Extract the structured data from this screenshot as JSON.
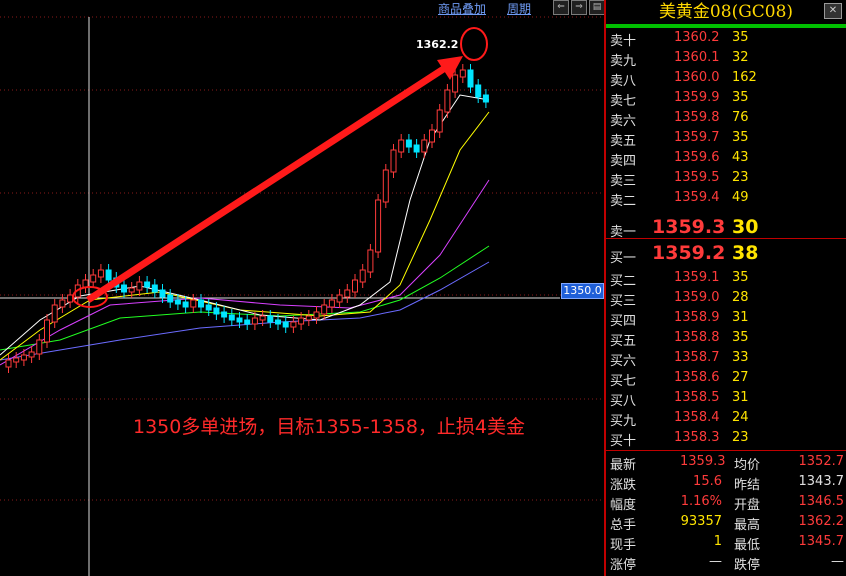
{
  "toolbar": {
    "overlay_label": "商品叠加",
    "period_label": "周期"
  },
  "chart": {
    "peak_label": "1362.2",
    "current_price_tag": "1350.0",
    "annotation": "1350多单进场，目标1355-1358，止损4美金",
    "colors": {
      "up": "#ff3b3b",
      "down": "#00e5ff",
      "ma5": "#ffffff",
      "ma10": "#ffff00",
      "ma20": "#d840ff",
      "ma30": "#22ff22",
      "ma60": "#6b6bff",
      "arrow": "#ff1a1a"
    }
  },
  "panel": {
    "title": "美黄金08(GC08)",
    "asks": [
      {
        "label": "卖十",
        "price": "1360.2",
        "vol": "35"
      },
      {
        "label": "卖九",
        "price": "1360.1",
        "vol": "32"
      },
      {
        "label": "卖八",
        "price": "1360.0",
        "vol": "162"
      },
      {
        "label": "卖七",
        "price": "1359.9",
        "vol": "35"
      },
      {
        "label": "卖六",
        "price": "1359.8",
        "vol": "76"
      },
      {
        "label": "卖五",
        "price": "1359.7",
        "vol": "35"
      },
      {
        "label": "卖四",
        "price": "1359.6",
        "vol": "43"
      },
      {
        "label": "卖三",
        "price": "1359.5",
        "vol": "23"
      },
      {
        "label": "卖二",
        "price": "1359.4",
        "vol": "49"
      },
      {
        "label": "卖一",
        "price": "1359.3",
        "vol": "30"
      }
    ],
    "bids": [
      {
        "label": "买一",
        "price": "1359.2",
        "vol": "38"
      },
      {
        "label": "买二",
        "price": "1359.1",
        "vol": "35"
      },
      {
        "label": "买三",
        "price": "1359.0",
        "vol": "28"
      },
      {
        "label": "买四",
        "price": "1358.9",
        "vol": "31"
      },
      {
        "label": "买五",
        "price": "1358.8",
        "vol": "35"
      },
      {
        "label": "买六",
        "price": "1358.7",
        "vol": "33"
      },
      {
        "label": "买七",
        "price": "1358.6",
        "vol": "27"
      },
      {
        "label": "买八",
        "price": "1358.5",
        "vol": "31"
      },
      {
        "label": "买九",
        "price": "1358.4",
        "vol": "24"
      },
      {
        "label": "买十",
        "price": "1358.3",
        "vol": "23"
      }
    ],
    "stats": {
      "latest_k": "最新",
      "latest_v": "1359.3",
      "avg_k": "均价",
      "avg_v": "1352.7",
      "change_k": "涨跌",
      "change_v": "15.6",
      "prevsettle_k": "昨结",
      "prevsettle_v": "1343.7",
      "range_k": "幅度",
      "range_v": "1.16%",
      "open_k": "开盘",
      "open_v": "1346.5",
      "total_k": "总手",
      "total_v": "93357",
      "high_k": "最高",
      "high_v": "1362.2",
      "cur_k": "现手",
      "cur_v": "1",
      "low_k": "最低",
      "low_v": "1345.7",
      "limitup_k": "涨停",
      "limitup_v": "—",
      "limitdown_k": "跌停",
      "limitdown_v": "—"
    }
  }
}
